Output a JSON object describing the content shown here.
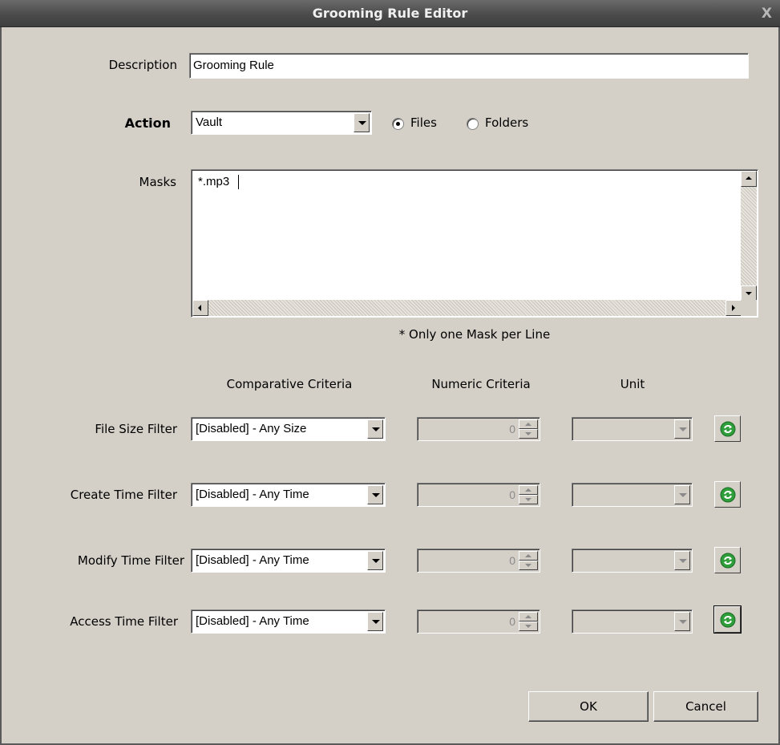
{
  "window": {
    "title": "Grooming Rule Editor",
    "close_glyph": "X"
  },
  "description": {
    "label": "Description",
    "value": "Grooming Rule"
  },
  "action": {
    "label": "Action",
    "selected": "Vault",
    "target_options": [
      {
        "label": "Files",
        "selected": true
      },
      {
        "label": "Folders",
        "selected": false
      }
    ]
  },
  "masks": {
    "label": "Masks",
    "value": "*.mp3",
    "hint": "* Only one Mask per Line"
  },
  "columns": {
    "comparative": "Comparative Criteria",
    "numeric": "Numeric Criteria",
    "unit": "Unit"
  },
  "filters": [
    {
      "label": "File Size Filter",
      "comparative": "[Disabled] - Any Size",
      "numeric": "0",
      "unit": ""
    },
    {
      "label": "Create Time Filter",
      "comparative": "[Disabled] - Any Time",
      "numeric": "0",
      "unit": ""
    },
    {
      "label": "Modify Time Filter",
      "comparative": "[Disabled] - Any Time",
      "numeric": "0",
      "unit": ""
    },
    {
      "label": "Access Time Filter",
      "comparative": "[Disabled] - Any Time",
      "numeric": "0",
      "unit": ""
    }
  ],
  "buttons": {
    "ok": "OK",
    "cancel": "Cancel"
  },
  "colors": {
    "dialog_bg": "#d4d0c8",
    "titlebar": "#4b4b4b",
    "refresh_green": "#2e9e3a"
  },
  "icons": {
    "refresh": "refresh-icon",
    "dropdown": "chevron-down-icon",
    "radio": "radio-icon"
  }
}
